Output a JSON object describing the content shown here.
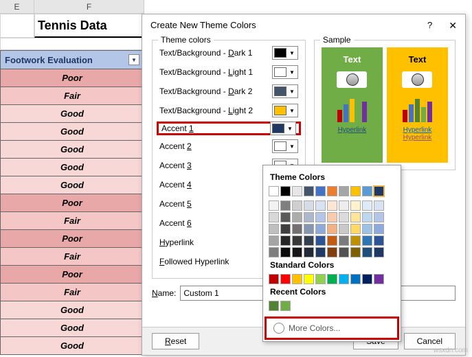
{
  "columns": [
    "E",
    "F"
  ],
  "title": "Tennis Data",
  "table": {
    "header": "Footwork Evaluation",
    "rows": [
      {
        "v": "Poor",
        "c": "poor"
      },
      {
        "v": "Fair",
        "c": "fair"
      },
      {
        "v": "Good",
        "c": "good"
      },
      {
        "v": "Good",
        "c": "good"
      },
      {
        "v": "Good",
        "c": "good"
      },
      {
        "v": "Good",
        "c": "good"
      },
      {
        "v": "Good",
        "c": "good"
      },
      {
        "v": "Poor",
        "c": "poor"
      },
      {
        "v": "Fair",
        "c": "fair"
      },
      {
        "v": "Poor",
        "c": "poor"
      },
      {
        "v": "Fair",
        "c": "fair"
      },
      {
        "v": "Poor",
        "c": "poor"
      },
      {
        "v": "Fair",
        "c": "fair"
      },
      {
        "v": "Good",
        "c": "good"
      },
      {
        "v": "Good",
        "c": "good"
      },
      {
        "v": "Good",
        "c": "good"
      }
    ]
  },
  "dialog": {
    "title": "Create New Theme Colors",
    "help": "?",
    "close": "✕",
    "theme_group": "Theme colors",
    "sample_group": "Sample",
    "items": [
      {
        "label": "Text/Background - Dark 1",
        "u": "D",
        "color": "#000000"
      },
      {
        "label": "Text/Background - Light 1",
        "u": "L",
        "color": "#ffffff"
      },
      {
        "label": "Text/Background - Dark 2",
        "u": "D",
        "color": "#44546a"
      },
      {
        "label": "Text/Background - Light 2",
        "u": "L",
        "color": "#ffc000"
      },
      {
        "label": "Accent 1",
        "u": "1",
        "color": "#1f3864",
        "hl": true
      },
      {
        "label": "Accent 2",
        "u": "2",
        "color": ""
      },
      {
        "label": "Accent 3",
        "u": "3",
        "color": ""
      },
      {
        "label": "Accent 4",
        "u": "4",
        "color": ""
      },
      {
        "label": "Accent 5",
        "u": "5",
        "color": ""
      },
      {
        "label": "Accent 6",
        "u": "6",
        "color": ""
      },
      {
        "label": "Hyperlink",
        "u": "H",
        "color": ""
      },
      {
        "label": "Followed Hyperlink",
        "u": "F",
        "color": ""
      }
    ],
    "name_label": "Name:",
    "name_u": "N",
    "name_value": "Custom 1",
    "reset": "Reset",
    "reset_u": "R",
    "save": "Save",
    "cancel": "Cancel",
    "sample": {
      "text": "Text",
      "hyperlink": "Hyperlink"
    }
  },
  "picker": {
    "theme_label": "Theme Colors",
    "standard_label": "Standard Colors",
    "recent_label": "Recent Colors",
    "theme_row1": [
      "#ffffff",
      "#000000",
      "#e7e6e6",
      "#44546a",
      "#4472c4",
      "#ed7d31",
      "#a5a5a5",
      "#ffc000",
      "#5b9bd5",
      "#1f3864"
    ],
    "shades": [
      [
        "#f2f2f2",
        "#7f7f7f",
        "#d0cece",
        "#d6dce4",
        "#d9e2f3",
        "#fbe5d5",
        "#ededed",
        "#fff2cc",
        "#deebf6",
        "#d9e2f3"
      ],
      [
        "#d8d8d8",
        "#595959",
        "#aeabab",
        "#adb9ca",
        "#b4c6e7",
        "#f7cbac",
        "#dbdbdb",
        "#fee599",
        "#bdd7ee",
        "#b4c6e7"
      ],
      [
        "#bfbfbf",
        "#3f3f3f",
        "#757070",
        "#8496b0",
        "#8eaadb",
        "#f4b183",
        "#c9c9c9",
        "#ffd965",
        "#9cc3e5",
        "#8eaadb"
      ],
      [
        "#a5a5a5",
        "#262626",
        "#3a3838",
        "#323f4f",
        "#2f5496",
        "#c55a11",
        "#7b7b7b",
        "#bf9000",
        "#2e75b5",
        "#2f5496"
      ],
      [
        "#7f7f7f",
        "#0c0c0c",
        "#171616",
        "#222a35",
        "#1f3864",
        "#833c0b",
        "#525252",
        "#7f6000",
        "#1e4e79",
        "#1f3864"
      ]
    ],
    "standard": [
      "#c00000",
      "#ff0000",
      "#ffc000",
      "#ffff00",
      "#92d050",
      "#00b050",
      "#00b0f0",
      "#0070c0",
      "#002060",
      "#7030a0"
    ],
    "recent": [
      "#548235",
      "#70ad47"
    ],
    "more": "More Colors..."
  },
  "watermark": "wsxdn.com"
}
